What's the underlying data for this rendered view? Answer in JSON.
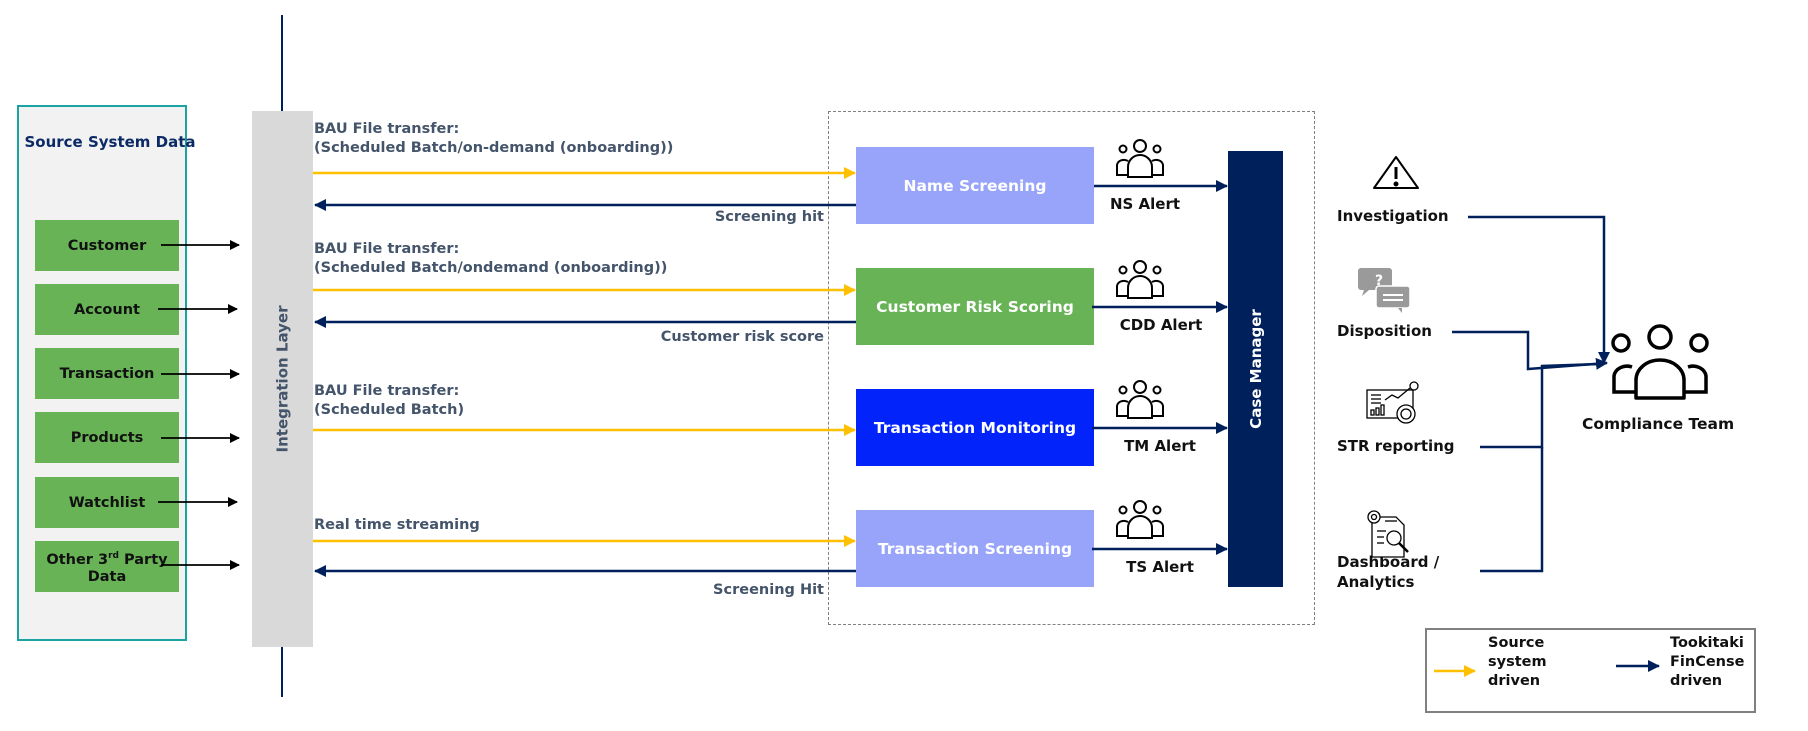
{
  "source_panel": {
    "title": "Source System Data",
    "items": [
      {
        "label": "Customer"
      },
      {
        "label": "Account"
      },
      {
        "label": "Transaction"
      },
      {
        "label": "Products"
      },
      {
        "label": "Watchlist"
      },
      {
        "label_main": "Other 3",
        "label_sup": "rd",
        "label_rest": " Party",
        "label_line2": "Data"
      }
    ]
  },
  "integration_layer": {
    "label": "Integration Layer"
  },
  "flows": [
    {
      "in_line1": "BAU File  transfer:",
      "in_line2": "(Scheduled Batch/on-demand (onboarding))",
      "return_label": "Screening hit"
    },
    {
      "in_line1": "BAU File  transfer:",
      "in_line2": "(Scheduled Batch/ondemand (onboarding))",
      "return_label": "Customer risk score"
    },
    {
      "in_line1": "BAU File  transfer:",
      "in_line2": "(Scheduled Batch)",
      "return_label": ""
    },
    {
      "in_line1": "Real time streaming",
      "in_line2": "",
      "return_label": "Screening Hit"
    }
  ],
  "modules": [
    {
      "label": "Name Screening",
      "color": "#98a4fa",
      "alert": "NS Alert"
    },
    {
      "label": "Customer Risk Scoring",
      "color": "#67b356",
      "alert": "CDD Alert"
    },
    {
      "label": "Transaction Monitoring",
      "color": "#0323fb",
      "alert": "TM Alert"
    },
    {
      "label": "Transaction Screening",
      "color": "#98a4fa",
      "alert": "TS Alert"
    }
  ],
  "case_manager": {
    "label": "Case Manager"
  },
  "outputs": [
    {
      "label": "Investigation",
      "icon": "warning-triangle-icon"
    },
    {
      "label": "Disposition",
      "icon": "chat-question-icon"
    },
    {
      "label": "STR reporting",
      "icon": "report-chart-icon"
    },
    {
      "label_line1": "Dashboard /",
      "label_line2": "Analytics",
      "icon": "document-search-icon"
    }
  ],
  "compliance": {
    "label": "Compliance Team"
  },
  "legend": {
    "source": {
      "line1": "Source",
      "line2": "system",
      "line3": "driven",
      "color": "#ffc000"
    },
    "tookitaki": {
      "line1": "Tookitaki",
      "line2": "FinCense",
      "line3": "driven",
      "color": "#00205b"
    }
  },
  "colors": {
    "source_arrow": "#ffc000",
    "fincense_arrow": "#00205b",
    "green": "#67b356",
    "case_manager": "#00205b"
  }
}
